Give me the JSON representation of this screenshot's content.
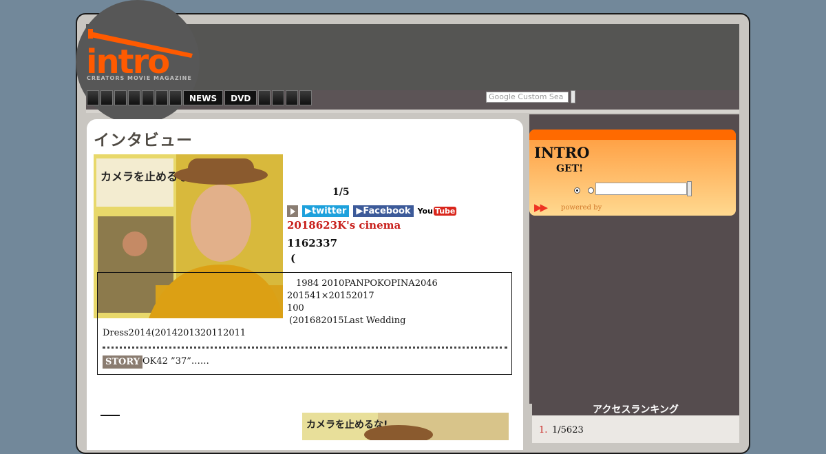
{
  "logo": {
    "text": "intro",
    "tagline": "CREATORS MOVIE MAGAZINE"
  },
  "nav": {
    "left_blank_tabs": 7,
    "items": [
      {
        "label": "NEWS"
      },
      {
        "label": "DVD"
      }
    ],
    "right_blank_tabs": 4
  },
  "search": {
    "placeholder": "Google Custom Search",
    "visible_text": "Google Custom Sea"
  },
  "main": {
    "page_title": "インタビュー",
    "photo_poster_text": "カメラを止めるな!",
    "counter": "1/5",
    "share": {
      "twitter": "twitter",
      "facebook": "Facebook",
      "youtube_a": "You",
      "youtube_b": "Tube"
    },
    "red_title": "2018623K's cinema",
    "subtitle": "1162337",
    "paren": "(",
    "profile_lines": [
      "1984 2010PANPOKOPINA2046",
      "201541×20152017",
      "100",
      "(201682015Last Wedding",
      "Dress2014(2014201320112011"
    ],
    "story_label": "STORY",
    "story_text": "OK42 ”37”……",
    "second_photo_text": "カメラを止めるな!"
  },
  "sidebar": {
    "widget_title": "INTRO",
    "widget_sub": "GET!",
    "arrows": "▶▶",
    "powered_by": "powered by",
    "ranking_title": "アクセスランキング",
    "ranking": [
      {
        "num": "1.",
        "text": "1/5623"
      }
    ]
  },
  "colors": {
    "accent_orange": "#ff6a00",
    "red_title": "#c8201c",
    "twitter": "#1ea1dc",
    "facebook": "#3c5a99"
  }
}
